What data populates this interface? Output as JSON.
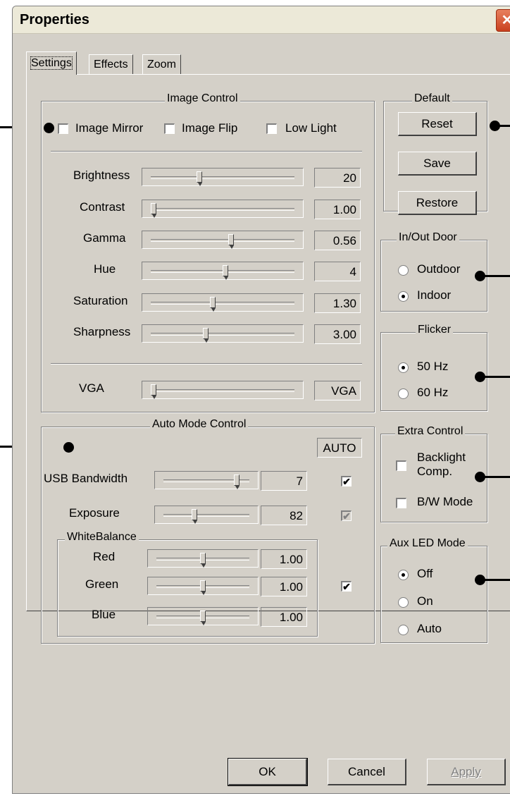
{
  "window": {
    "title": "Properties",
    "close_glyph": "✕"
  },
  "tabs": [
    {
      "label": "Settings",
      "selected": true
    },
    {
      "label": "Effects",
      "selected": false
    },
    {
      "label": "Zoom",
      "selected": false
    }
  ],
  "image_control": {
    "legend": "Image Control",
    "checkboxes": [
      {
        "label": "Image Mirror",
        "checked": false
      },
      {
        "label": "Image Flip",
        "checked": false
      },
      {
        "label": "Low Light",
        "checked": false
      }
    ],
    "sliders": [
      {
        "label": "Brightness",
        "value": "20",
        "level": 0.33
      },
      {
        "label": "Contrast",
        "value": "1.00",
        "level": 0.0
      },
      {
        "label": "Gamma",
        "value": "0.56",
        "level": 0.56
      },
      {
        "label": "Hue",
        "value": "4",
        "level": 0.52
      },
      {
        "label": "Saturation",
        "value": "1.30",
        "level": 0.43
      },
      {
        "label": "Sharpness",
        "value": "3.00",
        "level": 0.38
      }
    ],
    "vga": {
      "label": "VGA",
      "value": "VGA",
      "level": 0.0
    }
  },
  "default_group": {
    "legend": "Default",
    "reset": "Reset",
    "save": "Save",
    "restore": "Restore"
  },
  "inout_door": {
    "legend": "In/Out Door",
    "options": [
      {
        "label": "Outdoor",
        "selected": false
      },
      {
        "label": "Indoor",
        "selected": true
      }
    ]
  },
  "flicker": {
    "legend": "Flicker",
    "options": [
      {
        "label": "50 Hz",
        "selected": true
      },
      {
        "label": "60 Hz",
        "selected": false
      }
    ]
  },
  "extra_control": {
    "legend": "Extra Control",
    "backlight_line1": "Backlight",
    "backlight_line2": "Comp.",
    "bw_mode": "B/W Mode"
  },
  "aux_led": {
    "legend": "Aux LED Mode",
    "options": [
      {
        "label": "Off",
        "selected": true
      },
      {
        "label": "On",
        "selected": false
      },
      {
        "label": "Auto",
        "selected": false
      }
    ]
  },
  "auto_mode": {
    "legend": "Auto Mode Control",
    "auto_header": "AUTO",
    "usb_bandwidth": {
      "label": "USB Bandwidth",
      "value": "7",
      "level": 0.88,
      "auto": true
    },
    "exposure": {
      "label": "Exposure",
      "value": "82",
      "level": 0.35,
      "auto": true,
      "auto_disabled": true
    },
    "white_balance": {
      "legend": "WhiteBalance",
      "auto": true,
      "channels": [
        {
          "label": "Red",
          "value": "1.00",
          "level": 0.5
        },
        {
          "label": "Green",
          "value": "1.00",
          "level": 0.5
        },
        {
          "label": "Blue",
          "value": "1.00",
          "level": 0.5
        }
      ]
    }
  },
  "buttons": {
    "ok": "OK",
    "cancel": "Cancel",
    "apply": "Apply"
  },
  "check_glyph": "✔",
  "colors": {
    "title_bar": "#ece9d8",
    "dialog": "#d4d0c8",
    "close_button": "#d95a35"
  }
}
